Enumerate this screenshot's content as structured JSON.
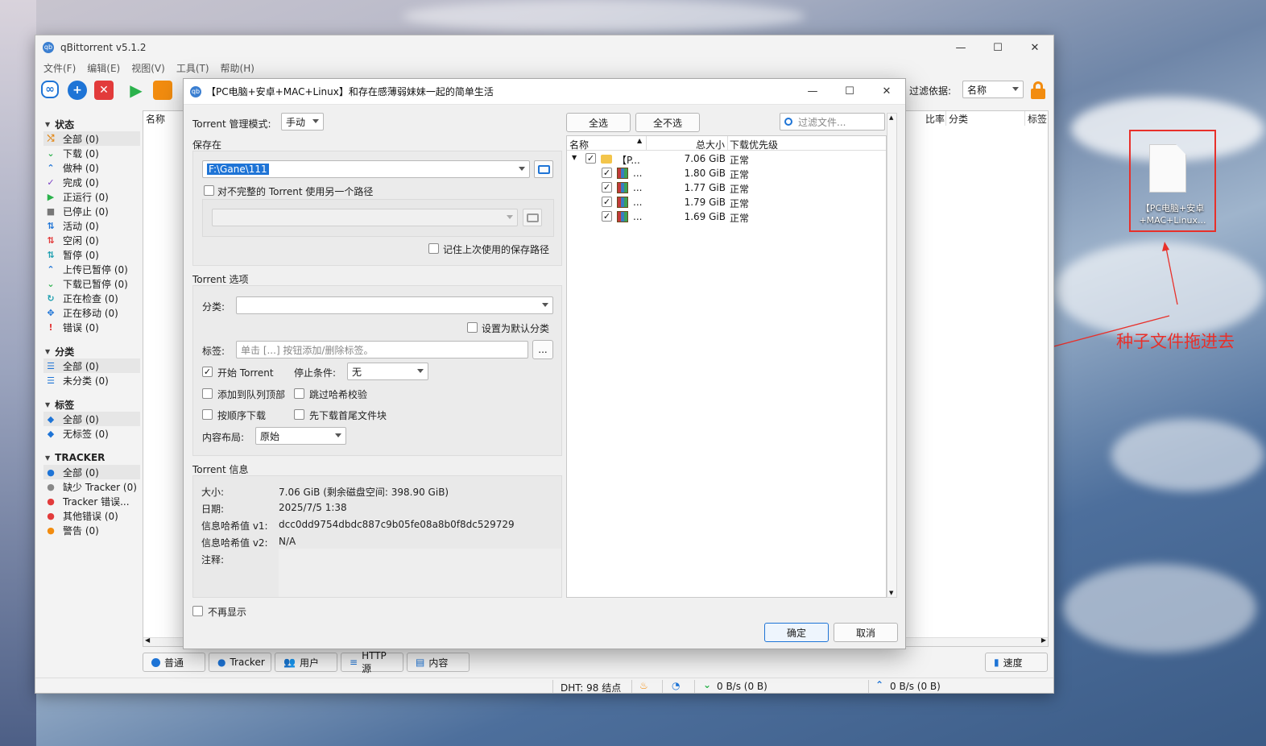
{
  "main_window": {
    "title": "qBittorrent v5.1.2",
    "controls": {
      "minimize": "—",
      "maximize": "☐",
      "close": "✕"
    },
    "menu": [
      "文件(F)",
      "编辑(E)",
      "视图(V)",
      "工具(T)",
      "帮助(H)"
    ],
    "filter_label": "过滤依据:",
    "filter_value": "名称",
    "columns": {
      "name": "名称",
      "ratio": "比率",
      "category": "分类",
      "tags": "标签"
    }
  },
  "sidebar": {
    "status_header": "状态",
    "status_items": [
      "全部 (0)",
      "下载 (0)",
      "做种 (0)",
      "完成 (0)",
      "正运行 (0)",
      "已停止 (0)",
      "活动 (0)",
      "空闲 (0)",
      "暂停 (0)",
      "上传已暂停 (0)",
      "下载已暂停 (0)",
      "正在检查 (0)",
      "正在移动 (0)",
      "错误 (0)"
    ],
    "category_header": "分类",
    "category_items": [
      "全部 (0)",
      "未分类 (0)"
    ],
    "tags_header": "标签",
    "tags_items": [
      "全部 (0)",
      "无标签 (0)"
    ],
    "tracker_header": "TRACKER",
    "tracker_items": [
      "全部 (0)",
      "缺少 Tracker (0)",
      "Tracker 错误...",
      "其他错误 (0)",
      "警告 (0)"
    ]
  },
  "bottom_tabs": [
    "普通",
    "Tracker",
    "用户",
    "HTTP 源",
    "内容"
  ],
  "speed_button": "速度",
  "statusbar": {
    "dht": "DHT: 98 结点",
    "download": "0 B/s (0 B)",
    "upload": "0 B/s (0 B)"
  },
  "dialog": {
    "title": "【PC电脑+安卓+MAC+Linux】和存在感薄弱妹妹一起的简单生活",
    "mgmt_mode_label": "Torrent 管理模式:",
    "mgmt_mode_value": "手动",
    "save_at_label": "保存在",
    "save_path": "F:\\Gane\\111",
    "incomplete_path_label": "对不完整的 Torrent 使用另一个路径",
    "remember_path_label": "记住上次使用的保存路径",
    "options_header": "Torrent 选项",
    "category_label": "分类:",
    "set_default_category": "设置为默认分类",
    "tags_label": "标签:",
    "tags_placeholder": "单击 [...] 按钮添加/删除标签。",
    "tags_button": "...",
    "start_torrent": "开始 Torrent",
    "stop_condition_label": "停止条件:",
    "stop_condition_value": "无",
    "add_to_top": "添加到队列顶部",
    "skip_hash": "跳过哈希校验",
    "sequential": "按顺序下载",
    "first_last": "先下载首尾文件块",
    "layout_label": "内容布局:",
    "layout_value": "原始",
    "info_header": "Torrent 信息",
    "info": [
      {
        "k": "大小:",
        "v": "7.06 GiB (剩余磁盘空间: 398.90 GiB)"
      },
      {
        "k": "日期:",
        "v": "2025/7/5 1:38"
      },
      {
        "k": "信息哈希值 v1:",
        "v": "dcc0dd9754dbdc887c9b05fe08a8b0f8dc529729"
      },
      {
        "k": "信息哈希值 v2:",
        "v": "N/A"
      },
      {
        "k": "注释:",
        "v": ""
      }
    ],
    "dont_show_again": "不再显示",
    "select_all": "全选",
    "select_none": "全不选",
    "filter_placeholder": "过滤文件...",
    "tree_headers": {
      "name": "名称",
      "size": "总大小",
      "priority": "下载优先级"
    },
    "tree_rows": [
      {
        "name": "【P...",
        "size": "7.06 GiB",
        "priority": "正常",
        "icon": "folder-icon"
      },
      {
        "name": "...",
        "size": "1.80 GiB",
        "priority": "正常",
        "icon": "archive-icon"
      },
      {
        "name": "...",
        "size": "1.77 GiB",
        "priority": "正常",
        "icon": "archive-icon"
      },
      {
        "name": "...",
        "size": "1.79 GiB",
        "priority": "正常",
        "icon": "archive-icon"
      },
      {
        "name": "...",
        "size": "1.69 GiB",
        "priority": "正常",
        "icon": "archive-icon"
      }
    ],
    "ok": "确定",
    "cancel": "取消"
  },
  "desktop": {
    "file_label": "【PC电脑+安卓+MAC+Linux...",
    "annotation": "种子文件拖进去",
    "annotation_color": "#e8302a"
  }
}
